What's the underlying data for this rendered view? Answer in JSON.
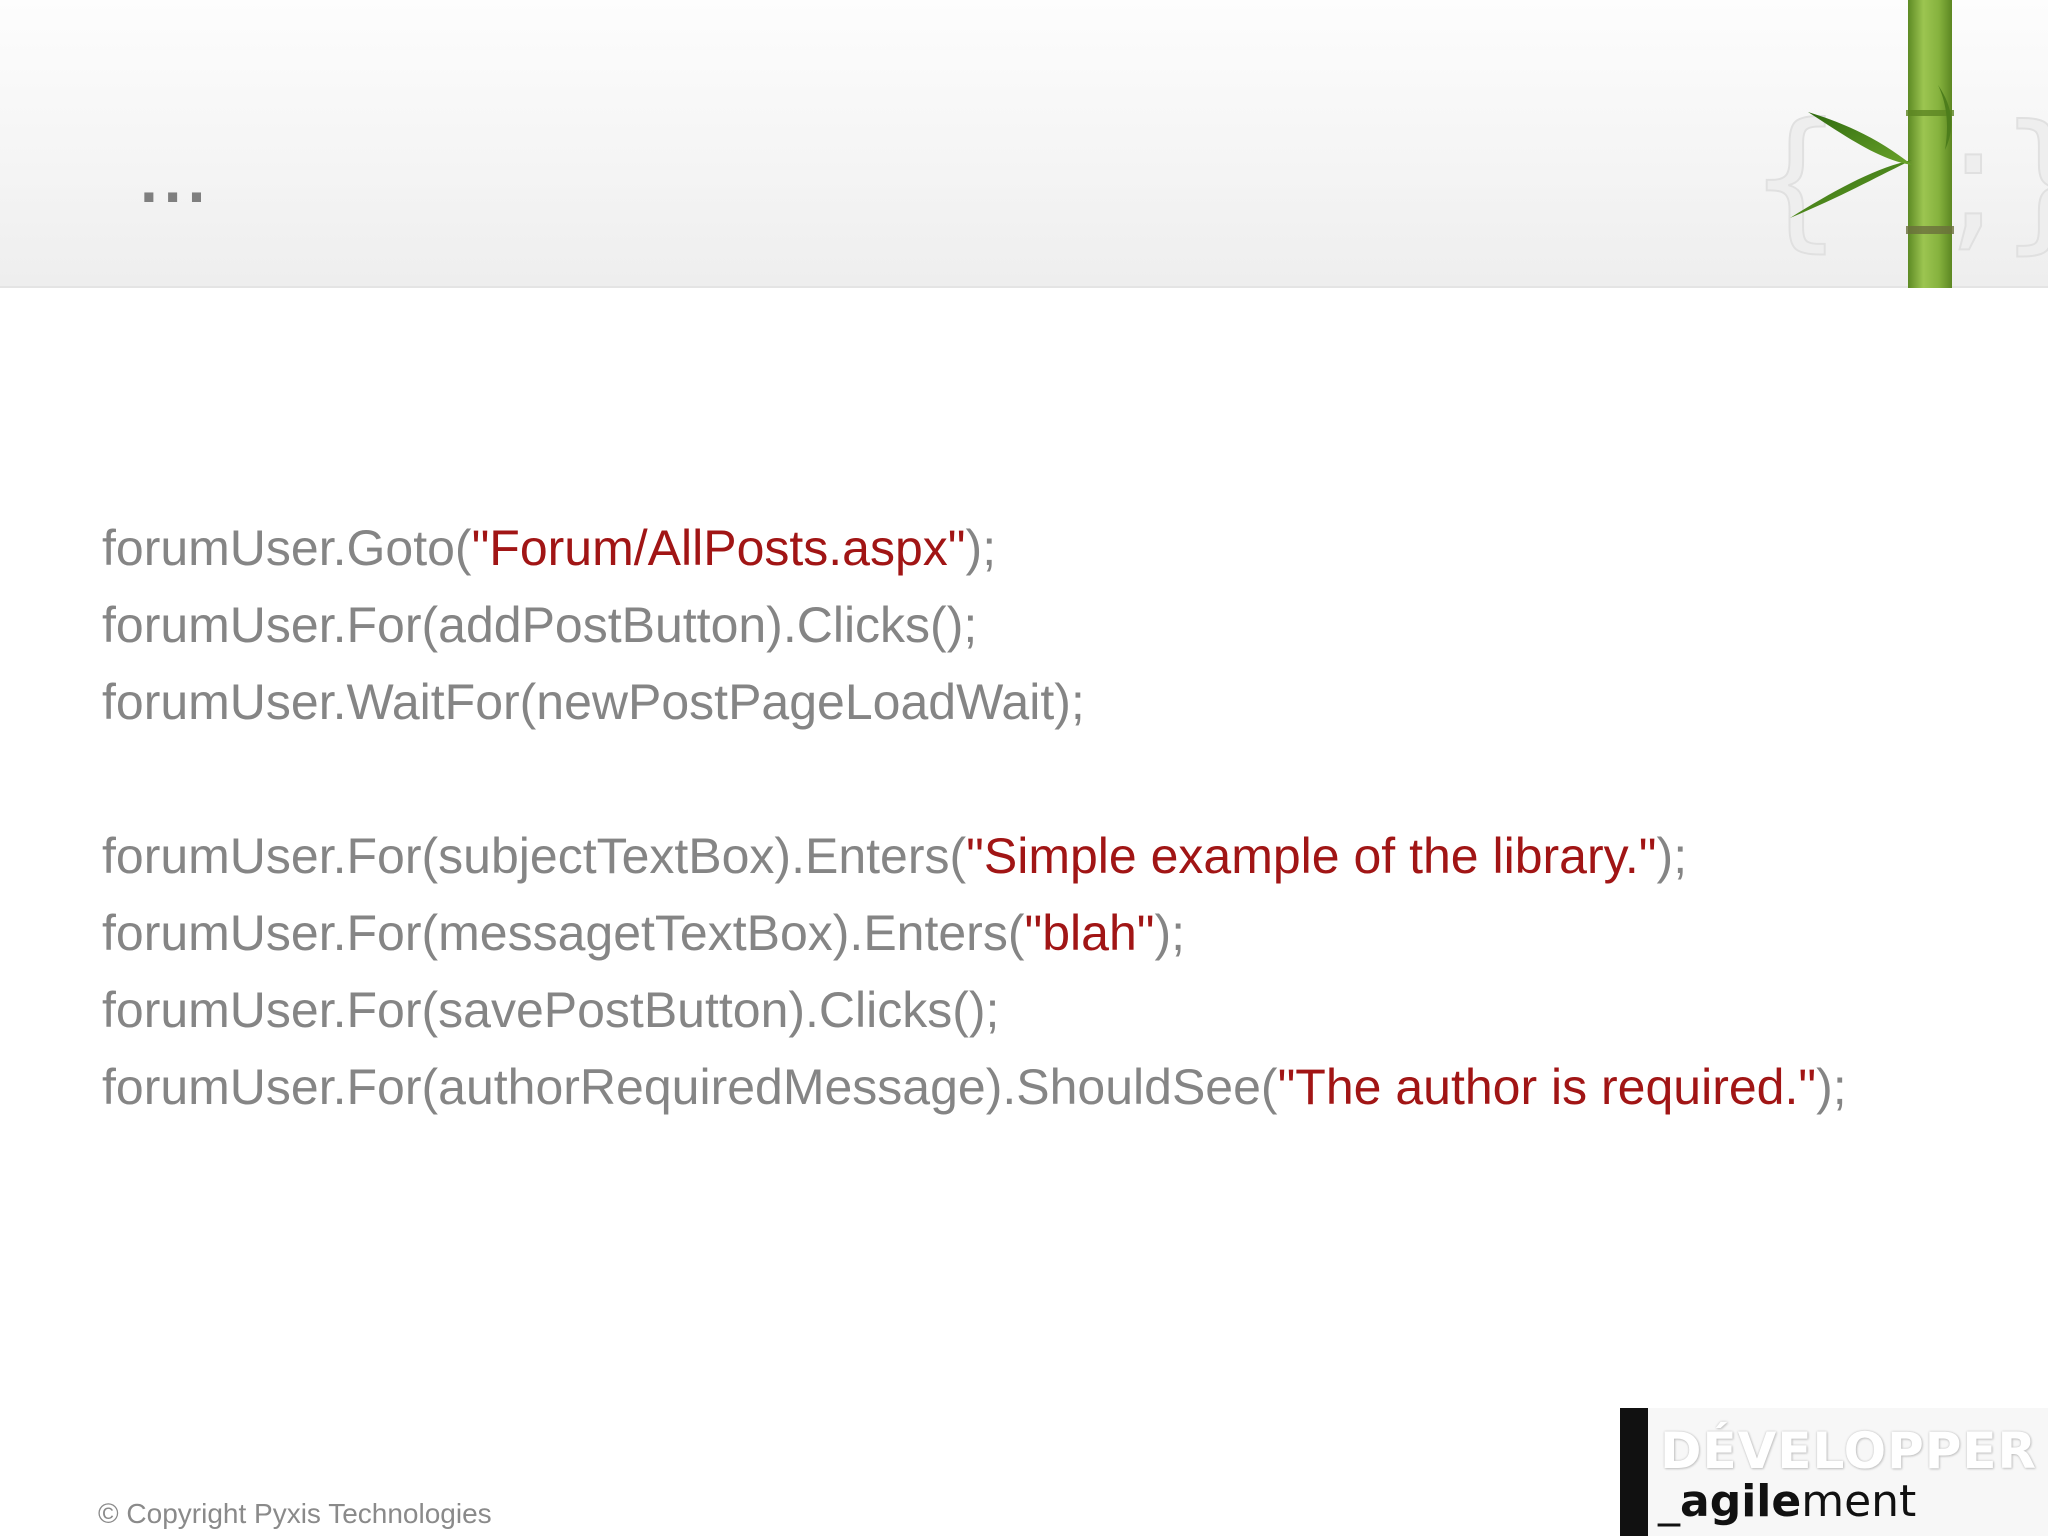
{
  "slide": {
    "title": "...",
    "code_lines": [
      [
        {
          "text": "forumUser.Goto("
        },
        {
          "text": "\"Forum/AllPosts.aspx\"",
          "str": true
        },
        {
          "text": ");"
        }
      ],
      [
        {
          "text": "forumUser.For(addPostButton).Clicks();"
        }
      ],
      [
        {
          "text": "forumUser.WaitFor(newPostPageLoadWait);"
        }
      ],
      [],
      [
        {
          "text": "forumUser.For(subjectTextBox).Enters("
        },
        {
          "text": "\"Simple example of the library.\"",
          "str": true
        },
        {
          "text": ");"
        }
      ],
      [
        {
          "text": "forumUser.For(messagetTextBox).Enters("
        },
        {
          "text": "\"blah\"",
          "str": true
        },
        {
          "text": ");"
        }
      ],
      [
        {
          "text": "forumUser.For(savePostButton).Clicks();"
        }
      ],
      [
        {
          "text": "forumUser.For(authorRequiredMessage).ShouldSee("
        },
        {
          "text": "\"The author is required.\"",
          "str": true
        },
        {
          "text": ");"
        }
      ]
    ],
    "copyright": "© Copyright Pyxis Technologies"
  },
  "logo": {
    "top_text": "DÉVELOPPER",
    "bottom_prefix": "_",
    "bottom_bold": "agile",
    "bottom_rest": "ment",
    "bracket_text": "{ ;}"
  },
  "colors": {
    "code_text": "#858585",
    "string_literal": "#a11515",
    "title": "#7f7f7f",
    "bamboo": "#7fae3c"
  }
}
